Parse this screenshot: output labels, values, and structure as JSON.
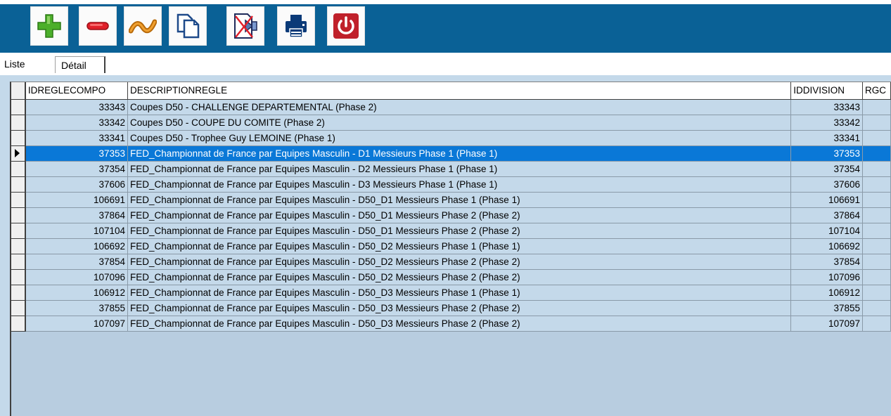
{
  "toolbar": {
    "buttons": [
      {
        "name": "add-button",
        "icon": "plus-icon"
      },
      {
        "name": "delete-button",
        "icon": "minus-icon"
      },
      {
        "name": "modify-button",
        "icon": "wave-icon"
      },
      {
        "name": "duplicate-button",
        "icon": "copy-icon"
      },
      {
        "name": "export-button",
        "icon": "export-icon"
      },
      {
        "name": "print-button",
        "icon": "printer-icon"
      },
      {
        "name": "quit-button",
        "icon": "power-icon"
      }
    ],
    "colors": {
      "band": "#0a6196",
      "plus": "#4caf2a",
      "minus": "#e0202a",
      "power": "#c0202a"
    }
  },
  "tabs": {
    "liste": "Liste",
    "detail": "Détail"
  },
  "grid": {
    "columns": [
      "IDREGLECOMPO",
      "DESCRIPTIONREGLE",
      "IDDIVISION",
      "RGC"
    ],
    "selected_index": 3,
    "rows": [
      {
        "id": "33343",
        "desc": "Coupes D50 - CHALLENGE DEPARTEMENTAL (Phase 2)",
        "div": "33343"
      },
      {
        "id": "33342",
        "desc": "Coupes D50 - COUPE DU COMITE (Phase 2)",
        "div": "33342"
      },
      {
        "id": "33341",
        "desc": "Coupes D50 - Trophee Guy LEMOINE (Phase 1)",
        "div": "33341"
      },
      {
        "id": "37353",
        "desc": "FED_Championnat de France par Equipes Masculin - D1 Messieurs Phase 1 (Phase 1)",
        "div": "37353"
      },
      {
        "id": "37354",
        "desc": "FED_Championnat de France par Equipes Masculin - D2 Messieurs Phase 1 (Phase 1)",
        "div": "37354"
      },
      {
        "id": "37606",
        "desc": "FED_Championnat de France par Equipes Masculin - D3 Messieurs Phase 1 (Phase 1)",
        "div": "37606"
      },
      {
        "id": "106691",
        "desc": "FED_Championnat de France par Equipes Masculin - D50_D1 Messieurs Phase 1 (Phase 1)",
        "div": "106691"
      },
      {
        "id": "37864",
        "desc": "FED_Championnat de France par Equipes Masculin - D50_D1 Messieurs Phase 2 (Phase 2)",
        "div": "37864"
      },
      {
        "id": "107104",
        "desc": "FED_Championnat de France par Equipes Masculin - D50_D1 Messieurs Phase 2 (Phase 2)",
        "div": "107104"
      },
      {
        "id": "106692",
        "desc": "FED_Championnat de France par Equipes Masculin - D50_D2 Messieurs Phase 1 (Phase 1)",
        "div": "106692"
      },
      {
        "id": "37854",
        "desc": "FED_Championnat de France par Equipes Masculin - D50_D2 Messieurs Phase 2 (Phase 2)",
        "div": "37854"
      },
      {
        "id": "107096",
        "desc": "FED_Championnat de France par Equipes Masculin - D50_D2 Messieurs Phase 2 (Phase 2)",
        "div": "107096"
      },
      {
        "id": "106912",
        "desc": "FED_Championnat de France par Equipes Masculin - D50_D3 Messieurs Phase 1 (Phase 1)",
        "div": "106912"
      },
      {
        "id": "37855",
        "desc": "FED_Championnat de France par Equipes Masculin - D50_D3 Messieurs Phase 2 (Phase 2)",
        "div": "37855"
      },
      {
        "id": "107097",
        "desc": "FED_Championnat de France par Equipes Masculin - D50_D3 Messieurs Phase 2 (Phase 2)",
        "div": "107097"
      }
    ]
  }
}
